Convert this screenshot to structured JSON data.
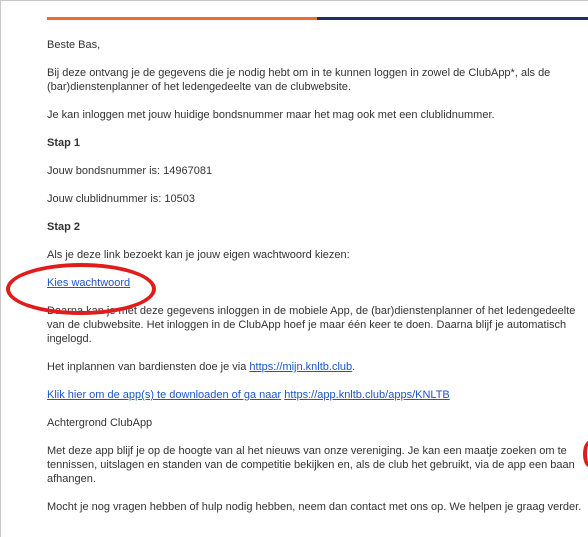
{
  "email": {
    "greeting": "Beste Bas,",
    "intro": "Bij deze ontvang je de gegevens die je nodig hebt om in te kunnen loggen in zowel de ClubApp*, als de (bar)dienstenplanner of het ledengedeelte van de clubwebsite.",
    "login_info": "Je kan inloggen met jouw huidige bondsnummer maar het mag ook met een clublidnummer.",
    "step1_heading": "Stap 1",
    "bondsnummer": "Jouw bondsnummer is: 14967081",
    "clublidnummer": "Jouw clublidnummer is: 10503",
    "step2_heading": "Stap 2",
    "link_intro": "Als je deze link bezoekt kan je jouw eigen wachtwoord kiezen:",
    "choose_password_link": "Kies wachtwoord",
    "after_password": "Daarna kan je met deze gegevens inloggen in de mobiele App, de (bar)dienstenplanner of het ledengedeelte van de clubwebsite. Het inloggen in de ClubApp hoef je maar één keer te doen. Daarna blijf je automatisch ingelogd.",
    "bardiensten_text": "Het inplannen van bardiensten doe je via ",
    "bardiensten_link": "https://mijn.knltb.club",
    "bardiensten_suffix": ".",
    "download_link": "Klik hier om de app(s) te downloaden of ga naar",
    "download_url": "https://app.knltb.club/apps/KNLTB",
    "background_heading": "Achtergrond ClubApp",
    "background_text": "Met deze app blijf je op de hoogte van al het nieuws van onze vereniging. Je kan een maatje zoeken om te tennissen, uitslagen en standen van de competitie bekijken en, als de club het gebruikt, via de app een baan afhangen.",
    "closing": "Mocht je nog vragen hebben of hulp nodig hebben, neem dan contact met ons op. We helpen je graag verder."
  },
  "colors": {
    "accent_orange": "#ef6c2a",
    "accent_navy": "#1f2d6b",
    "link": "#1a56c4",
    "annotation_red": "#e01c1c"
  }
}
